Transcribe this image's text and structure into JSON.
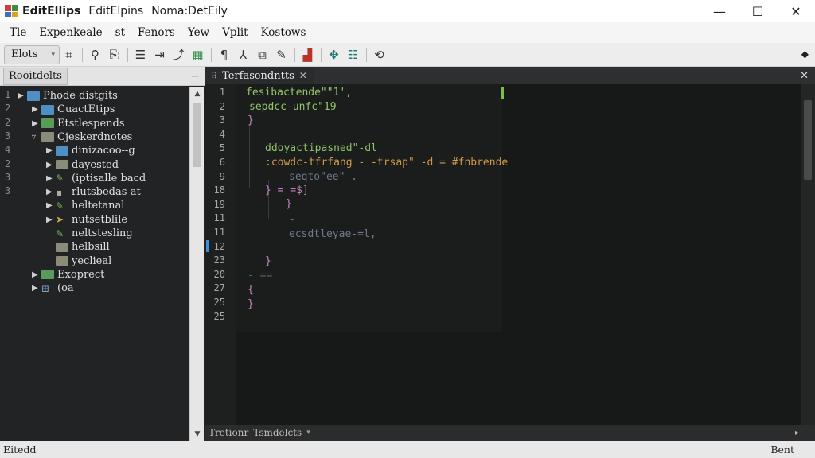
{
  "window": {
    "title_parts": [
      "EditEllips",
      "EditElpins",
      "Noma:DetEily"
    ],
    "colors": {
      "logo": [
        "#d23f3f",
        "#3e8e41",
        "#3b6fc8",
        "#e0a020"
      ]
    },
    "controls": {
      "minimize": "—",
      "maximize": "☐",
      "close": "✕"
    }
  },
  "menu": {
    "items": [
      "Tle",
      "Expenkeale",
      "st",
      "Fenors",
      "Yew",
      "Vplit",
      "Kostows"
    ]
  },
  "toolbar": {
    "select_value": "Elots",
    "icons": [
      "grid-icon",
      "magnifier-icon",
      "find-file-icon",
      "list-icon",
      "indent-icon",
      "rebase-icon",
      "package-icon",
      "paragraph-icon",
      "branch-icon",
      "bookmark-icon",
      "pen-icon",
      "bar-chart-icon",
      "compass-icon",
      "settings-lines-icon",
      "cycle-icon"
    ]
  },
  "left_panel": {
    "tab_label": "Rooitdelts",
    "minimize": "−",
    "line_numbers": [
      "1",
      "2",
      "2",
      "3",
      "4",
      "2",
      "3",
      "3"
    ],
    "tree": [
      {
        "label": "Phode distgits",
        "icon": "folder-blue",
        "arrow": "▸",
        "indent": 0
      },
      {
        "label": "CuactEtips",
        "icon": "folder-blue",
        "arrow": "▸",
        "indent": 1
      },
      {
        "label": "Etstlespends",
        "icon": "folder-green",
        "arrow": "▸",
        "indent": 1
      },
      {
        "label": "Cjeskerdnotes",
        "icon": "folder-gray",
        "arrow": "▾",
        "indent": 1
      },
      {
        "label": "dinizacoo--g",
        "icon": "folder-blue",
        "arrow": "▸",
        "indent": 2
      },
      {
        "label": "dayested--",
        "icon": "folder-gray",
        "arrow": "▸",
        "indent": 2
      },
      {
        "label": "(iptisalle bacd",
        "icon": "file-edit",
        "arrow": "▸",
        "indent": 2
      },
      {
        "label": "rlutsbedas-at",
        "icon": "file-gray",
        "arrow": "▸",
        "indent": 2
      },
      {
        "label": "heltetanal",
        "icon": "file-edit",
        "arrow": "▸",
        "indent": 2
      },
      {
        "label": "nutsetblile",
        "icon": "file-arrow",
        "arrow": "▸",
        "indent": 2
      },
      {
        "label": "neltstesling",
        "icon": "file-edit",
        "arrow": "",
        "indent": 2
      },
      {
        "label": "helbsill",
        "icon": "folder-gray",
        "arrow": "",
        "indent": 2
      },
      {
        "label": "yeclieal",
        "icon": "folder-gray",
        "arrow": "",
        "indent": 2
      },
      {
        "label": "Exoprect",
        "icon": "folder-green",
        "arrow": "▸",
        "indent": 1
      },
      {
        "label": "(oa",
        "icon": "file-grid",
        "arrow": "▸",
        "indent": 1
      }
    ]
  },
  "editor": {
    "tab_label": "Terfasendntts",
    "tab_close": "✕",
    "panel_close": "✕",
    "line_numbers": [
      "1",
      "2",
      "3",
      "4",
      "5",
      "6",
      "9",
      "18",
      "19",
      "11",
      "11",
      "12",
      "23",
      "20",
      "27",
      "25",
      "25"
    ],
    "code_lines": [
      {
        "text": "fesibactende\"\"1',",
        "cls": "c-green"
      },
      {
        "text": "sepdcc-unfc\"19",
        "cls": "c-green"
      },
      {
        "text": "}",
        "cls": "c-purple"
      },
      {
        "text": "ddoyactipasned\"-dl",
        "cls": "c-green"
      },
      {
        "text": ":cowdc-tfrfang - -trsap\" -d = #fnbrende",
        "cls": "c-orange"
      },
      {
        "text": "seqto\"ee\"-.",
        "cls": "c-dim"
      },
      {
        "text": "}          = =$]",
        "cls": "c-purple"
      },
      {
        "text": "}",
        "cls": "c-purple"
      },
      {
        "text": "-",
        "cls": "c-dim"
      },
      {
        "text": "ecsdtleyae-=l,",
        "cls": "c-dim"
      },
      {
        "text": "}",
        "cls": "c-purple"
      },
      {
        "text": "- ==",
        "cls": "c-faint"
      },
      {
        "text": "{",
        "cls": "c-purple"
      },
      {
        "text": "}",
        "cls": "c-purple"
      }
    ],
    "bottom_tabs": [
      "Tretionr",
      "Tsmdelcts"
    ],
    "bottom_arrow": "▸"
  },
  "status": {
    "left": "Eitedd",
    "right": "Bent"
  }
}
